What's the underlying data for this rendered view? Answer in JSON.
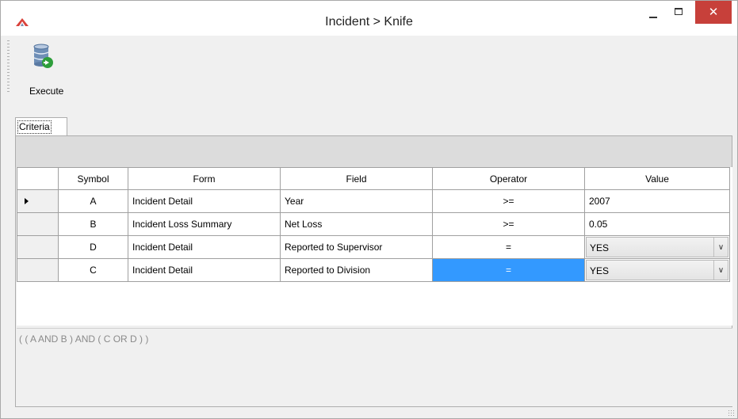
{
  "window": {
    "title": "Incident > Knife",
    "close_glyph": "✕"
  },
  "toolbar": {
    "execute_label": "Execute",
    "execute_icon": "database-run-icon"
  },
  "tabs": [
    {
      "label": "Criteria",
      "selected": true
    }
  ],
  "grid": {
    "columns": [
      "Symbol",
      "Form",
      "Field",
      "Operator",
      "Value"
    ],
    "rows": [
      {
        "symbol": "A",
        "form": "Incident Detail",
        "field": "Year",
        "operator": ">=",
        "value": "2007",
        "current": true
      },
      {
        "symbol": "B",
        "form": "Incident Loss Summary",
        "field": "Net Loss",
        "operator": ">=",
        "value": "0.05"
      },
      {
        "symbol": "D",
        "form": "Incident Detail",
        "field": "Reported to Supervisor",
        "operator": "=",
        "value": "YES",
        "dropdown": true
      },
      {
        "symbol": "C",
        "form": "Incident Detail",
        "field": "Reported to Division",
        "operator": "=",
        "value": "YES",
        "dropdown": true,
        "operator_selected": true
      }
    ]
  },
  "expression": "( ( A AND B ) AND ( C OR D ) )",
  "colors": {
    "selection": "#3399ff",
    "close_button": "#c7403a",
    "expression_text": "#8a8a8a"
  }
}
